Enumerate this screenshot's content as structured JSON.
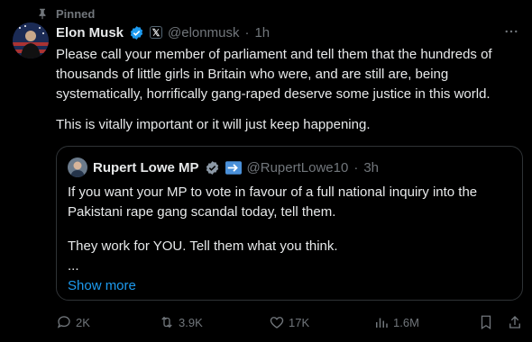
{
  "pinned_label": "Pinned",
  "author": {
    "name": "Elon Musk",
    "handle": "@elonmusk",
    "separator": "·",
    "time": "1h"
  },
  "post_text": [
    "Please call your member of parliament and tell them that the hundreds of thousands of little girls in Britain who were, and are still are, being systematically, horrifically gang-raped deserve some justice in this world.",
    "This is vitally important or it will just keep happening."
  ],
  "quoted": {
    "name": "Rupert Lowe MP",
    "handle": "@RupertLowe10",
    "separator": "·",
    "time": "3h",
    "text": [
      "If you want your MP to vote in favour of a full national inquiry into the Pakistani rape gang scandal today, tell them.",
      "They work for YOU. Tell them what you think.",
      "..."
    ],
    "show_more": "Show more"
  },
  "actions": {
    "replies": "2K",
    "reposts": "3.9K",
    "likes": "17K",
    "views": "1.6M"
  },
  "colors": {
    "background": "#000000",
    "text": "#e7e9ea",
    "muted": "#71767b",
    "accent": "#1d9bf0",
    "border": "#2f3336",
    "verified": "#1d9bf0"
  },
  "icons": {
    "pin": "pin-icon",
    "verified": "verified-badge-icon",
    "x_affiliate": "x-logo-icon",
    "more": "more-icon",
    "reply": "reply-icon",
    "repost": "repost-icon",
    "like": "like-icon",
    "views": "views-icon",
    "bookmark": "bookmark-icon",
    "share": "share-icon"
  }
}
